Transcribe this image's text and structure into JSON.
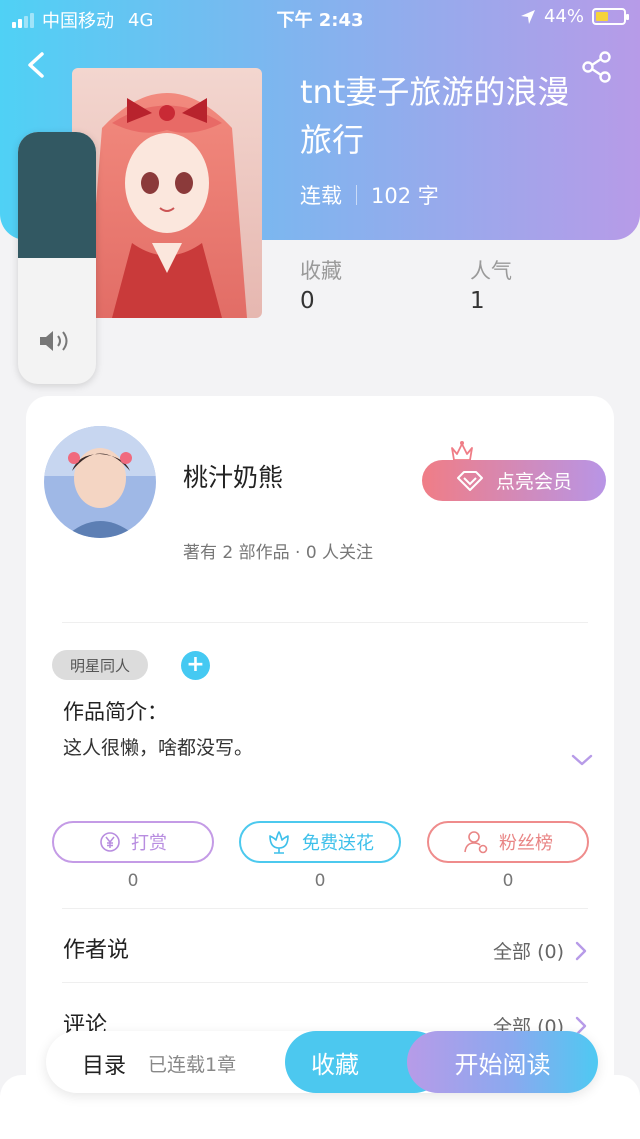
{
  "status_bar": {
    "carrier": "中国移动",
    "network": "4G",
    "time": "下午 2:43",
    "battery": "44%"
  },
  "book": {
    "title": "tnt妻子旅游的浪漫旅行",
    "status": "连载",
    "word_count": "102 字",
    "stats": [
      {
        "label": "收藏",
        "value": "0"
      },
      {
        "label": "人气",
        "value": "1"
      }
    ]
  },
  "volume": {
    "level_fraction": 0.5
  },
  "author": {
    "name": "桃汁奶熊",
    "info": "著有 2 部作品 · 0 人关注",
    "vip_button": "点亮会员"
  },
  "tags": [
    "明星同人"
  ],
  "intro": {
    "title": "作品简介：",
    "text": "这人很懒，啥都没写。"
  },
  "actions": [
    {
      "label": "打赏",
      "count": "0"
    },
    {
      "label": "免费送花",
      "count": "0"
    },
    {
      "label": "粉丝榜",
      "count": "0"
    }
  ],
  "sections": [
    {
      "title": "作者说",
      "right": "全部 (0)"
    },
    {
      "title": "评论",
      "right": "全部 (0)"
    }
  ],
  "bottom_bar": {
    "toc": "目录",
    "progress": "已连载1章",
    "favorite": "收藏",
    "read": "开始阅读"
  },
  "colors": {
    "header_start": "#4fd1f5",
    "header_end": "#b79be8",
    "accent_blue": "#4cc8ef",
    "accent_purple": "#b79be8",
    "tip_color": "#c49be6",
    "fans_color": "#ef8c8c"
  }
}
